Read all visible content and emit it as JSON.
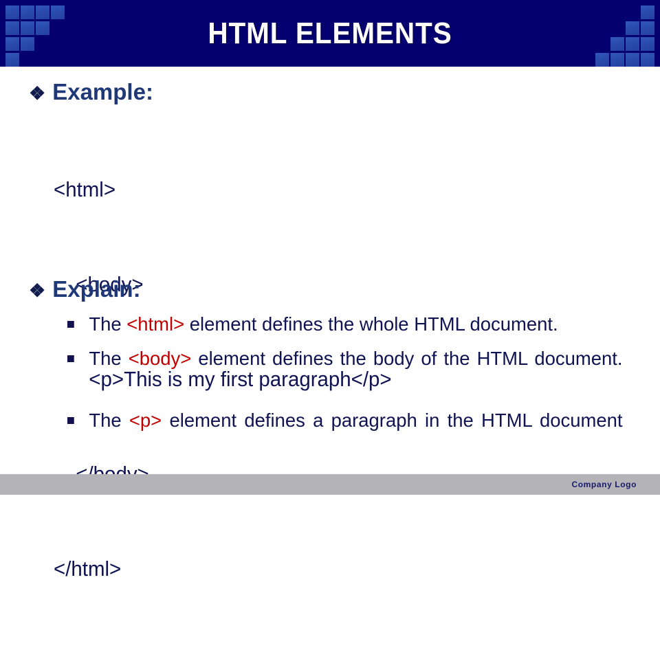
{
  "slide": {
    "title": "HTML ELEMENTS",
    "theme": {
      "header_bg": "#050070",
      "deco_square": "#2a49ab",
      "heading_color": "#1f3878",
      "body_color": "#0f1352",
      "tag_color": "#c00000",
      "footer_bg": "#b4b4b8",
      "footer_text": "#171a6b"
    }
  },
  "sections": {
    "example": {
      "bullet_glyph": "❖",
      "heading": "Example:",
      "code_lines": [
        {
          "indent": 0,
          "text": "<html>"
        },
        {
          "indent": 1,
          "text": "<body>"
        },
        {
          "indent": 2,
          "text": "<p>This is my first paragraph</p>"
        },
        {
          "indent": 1,
          "text": "</body>"
        },
        {
          "indent": 0,
          "text": "</html>"
        }
      ]
    },
    "explain": {
      "bullet_glyph": "❖",
      "heading": "Explain:",
      "items": [
        {
          "marker": "square-bullet",
          "prefix": "The ",
          "tag": "<html>",
          "suffix": " element defines the whole HTML document."
        },
        {
          "marker": "square-bullet",
          "prefix": "The ",
          "tag": "<body>",
          "suffix": " element defines the body of the HTML document."
        },
        {
          "marker": "square-bullet",
          "prefix": "The ",
          "tag": "<p>",
          "suffix": " element defines a paragraph in the HTML document"
        }
      ]
    }
  },
  "footer": {
    "logo_text": "Company  Logo"
  }
}
